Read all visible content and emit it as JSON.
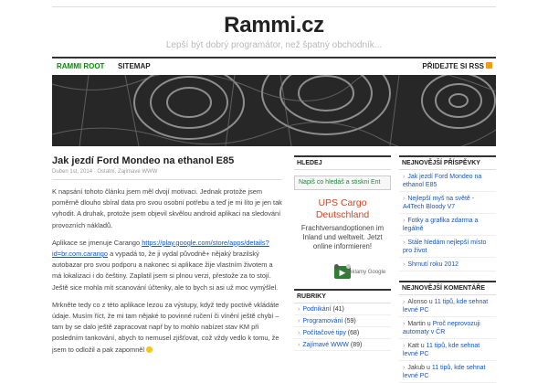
{
  "site": {
    "title": "Rammi.cz",
    "tagline": "Lepší být dobrý programátor, než špatný obchodník..."
  },
  "nav": {
    "items": [
      "RAMMI ROOT",
      "SITEMAP"
    ],
    "rss": "PŘIDEJTE SI RSS"
  },
  "post": {
    "title": "Jak jezdí Ford Mondeo na ethanol E85",
    "meta": "Duben 1st, 2014 · Ostatní, Zajímavé WWW",
    "p1": "K napsání tohoto článku jsem měl dvojí motivaci. Jednak protože jsem poměrně dlouho sbíral data pro svou osobní potřebu a teď je mi líto je jen tak vyhodit. A druhak, protože jsem objevil skvělou android aplikaci na sledování provozních nákladů.",
    "p2_pre": "Aplikace se jmenuje Carango ",
    "p2_link": "https://play.google.com/store/apps/details?id=br.com.carango",
    "p2_post": " a vypadá to, že ji vydal původně+ nějaký brazilský autobazar pro svou podporu a nakonec si aplikace žije vlastním životem a má lokalizaci i do češtiny. Zaplatil jsem si plnou verzi, přestože za to stojí. Ještě sice mohla mít scanování účtenky, ale to bych si asi už moc vymýšlel.",
    "p3": "Mrkněte tedy co z této aplikace lezou za výstupy, když tedy poctivě vkládáte údaje. Musím říct, že mi tam nějaké to povinné ručení či vínění ještě chybí – tam by se dalo ještě zapracovat např by to mohlo nabízet stav KM při posledním tankování, abych to nemusel zjišťovat, což vždy vedlo k tomu, že jsem to odložil a pak zapomněl"
  },
  "search": {
    "title": "HLEDEJ",
    "placeholder": "Napiš co hledáš a stiskni Ent"
  },
  "ad": {
    "title": "UPS Cargo Deutschland",
    "text": "Frachtversandoptionen im Inland und weltweit. Jetzt online informieren!",
    "reklama": "Reklamy Google"
  },
  "categories": {
    "title": "RUBRIKY",
    "items": [
      {
        "label": "Podnikání",
        "count": "(41)"
      },
      {
        "label": "Programování",
        "count": "(59)"
      },
      {
        "label": "Počítačové tipy",
        "count": "(68)"
      },
      {
        "label": "Zajímavé WWW",
        "count": "(89)"
      }
    ]
  },
  "recent_posts": {
    "title": "NEJNOVĚJŠÍ PŘÍSPĚVKY",
    "items": [
      "Jak jezdí Ford Mondeo na ethanol E85",
      "Nejlepší myš na světě - A4Tech Bloody V7",
      "Fotky a grafika zdarma a legálně",
      "Stále hledám nejlepší místo pro život",
      "Shrnutí roku 2012"
    ]
  },
  "recent_comments": {
    "title": "NEJNOVĚJŠÍ KOMENTÁŘE",
    "items": [
      {
        "author": "Alonso",
        "sep": " u ",
        "link": "11 tipů, kde sehnat levné PC"
      },
      {
        "author": "Martin",
        "sep": " u ",
        "link": "Proč neprovozuji automaty v ČR"
      },
      {
        "author": "Katt",
        "sep": " u ",
        "link": "11 tipů, kde sehnat levné PC"
      },
      {
        "author": "Jakub",
        "sep": " u ",
        "link": "11 tipů, kde sehnat levné PC"
      }
    ]
  },
  "colors": {
    "accent_green": "#0b8a0b",
    "link_blue": "#1155cc",
    "ad_orange": "#e0401d"
  }
}
